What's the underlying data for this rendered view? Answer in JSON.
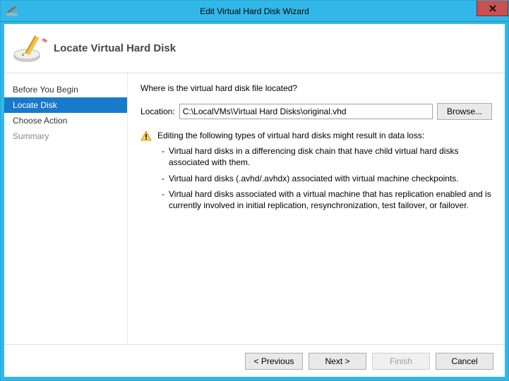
{
  "window": {
    "title": "Edit Virtual Hard Disk Wizard"
  },
  "header": {
    "title": "Locate Virtual Hard Disk"
  },
  "sidebar": {
    "items": [
      {
        "label": "Before You Begin",
        "selected": false,
        "dim": false
      },
      {
        "label": "Locate Disk",
        "selected": true,
        "dim": false
      },
      {
        "label": "Choose Action",
        "selected": false,
        "dim": false
      },
      {
        "label": "Summary",
        "selected": false,
        "dim": true
      }
    ]
  },
  "main": {
    "prompt": "Where is the virtual hard disk file located?",
    "location_label": "Location:",
    "location_value": "C:\\LocalVMs\\Virtual Hard Disks\\original.vhd",
    "browse_label": "Browse...",
    "warning_intro": "Editing the following types of virtual hard disks might result in data loss:",
    "warning_items": [
      "Virtual hard disks in a differencing disk chain that have child virtual hard disks associated with them.",
      "Virtual hard disks (.avhd/.avhdx) associated with virtual machine checkpoints.",
      "Virtual hard disks associated with a virtual machine that has replication enabled and is currently involved in initial replication, resynchronization, test failover, or failover."
    ]
  },
  "footer": {
    "previous": "< Previous",
    "next": "Next >",
    "finish": "Finish",
    "cancel": "Cancel"
  }
}
